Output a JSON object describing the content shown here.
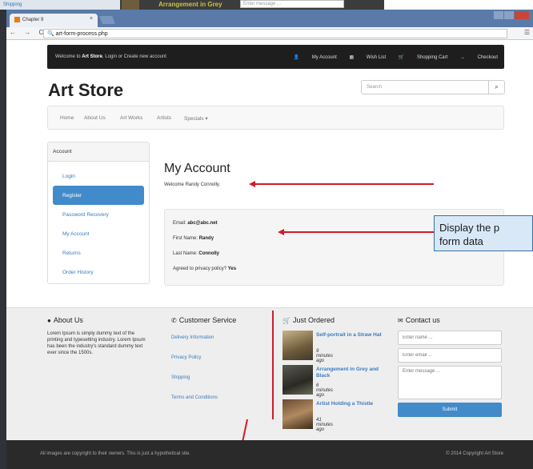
{
  "background_window": {
    "left_link": "Shipping",
    "title": "Arrangement in Grey",
    "input_placeholder": "Enter message ..."
  },
  "browser": {
    "tab_title": "Chapter 9",
    "tab_close": "×",
    "url": "art-form-process.php",
    "nav_buttons": "← → C"
  },
  "topbar": {
    "welcome_prefix": "Welcome to",
    "store_name": "Art Store",
    "welcome_suffix": ", Login or Create new account",
    "links": [
      "My Account",
      "Wish List",
      "Shopping Cart",
      "Checkout"
    ]
  },
  "header": {
    "brand": "Art Store",
    "search_placeholder": "Search"
  },
  "nav": {
    "items": [
      "Home",
      "About Us",
      "Art Works",
      "Artists",
      "Specials ▾"
    ]
  },
  "sidebar": {
    "heading": "Account",
    "items": [
      "Login",
      "Register",
      "Password Recovery",
      "My Account",
      "Returns",
      "Order History"
    ]
  },
  "account": {
    "title": "My Account",
    "welcome": "Welcome Randy Connolly.",
    "email_label": "Email:",
    "email": "abc@abc.net",
    "first_label": "First Name:",
    "first": "Randy",
    "last_label": "Last Name:",
    "last": "Connolly",
    "privacy_label": "Agreed to privacy policy?",
    "privacy": "Yes"
  },
  "callout": {
    "line1": "Display the p",
    "line2": "form data"
  },
  "footer": {
    "about_title": "About Us",
    "about_text": "Lorem Ipsum is simply dummy text of the printing and typesetting industry. Lorem Ipsum has been the industry's standard dummy text ever since the 1500s.",
    "service_title": "Customer Service",
    "service_links": [
      "Delivery Information",
      "Privacy Policy",
      "Shipping",
      "Terms and Conditions"
    ],
    "ordered_title": "Just Ordered",
    "orders": [
      {
        "title": "Self-portrait in a Straw Hat",
        "time": "9 minutes ago"
      },
      {
        "title": "Arrangement in Grey and Black",
        "time": "6 minutes ago"
      },
      {
        "title": "Artist Holding a Thistle",
        "time": "41 minutes ago"
      }
    ],
    "contact_title": "Contact us",
    "name_placeholder": "Enter name ...",
    "email_placeholder": "Enter email ...",
    "message_placeholder": "Enter message ...",
    "submit": "Submit"
  },
  "bottom": {
    "left": "All images are copyright to their owners. This is just a hypothetical site.",
    "right": "© 2014 Copyright Art Store"
  }
}
